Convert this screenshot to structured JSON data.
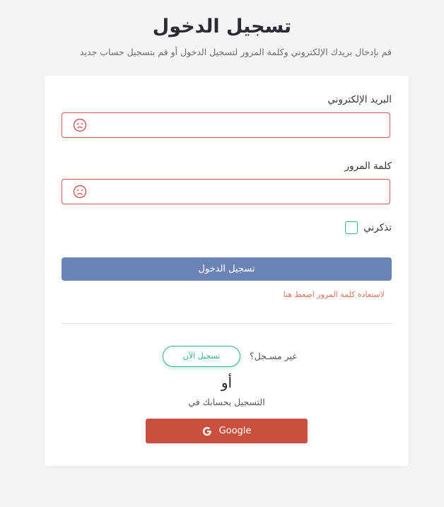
{
  "header": {
    "title": "تسجيل الدخول",
    "subtitle": "قم بإدخال بريدك الإلكتروني وكلمة المرور لتسجيل الدخول أو قم بتسجيل حساب جديد"
  },
  "form": {
    "email_label": "البريد الإلكتروني",
    "email_value": "",
    "password_label": "كلمة المرور",
    "password_value": "",
    "remember_label": "تذكرني",
    "remember_checked": false,
    "submit_label": "تسجيل الدخول",
    "forgot_link": "لاستعادة كلمة المرور اضغط هنا",
    "field_error_icon": "sad-face-icon",
    "error_color": "#d9534f"
  },
  "signup": {
    "prompt": "غير مسـجل؟",
    "register_button": "تسجيل الآن",
    "or_text": "أو",
    "social_prompt": "التسجيل بحسابك في",
    "google_button": "Google",
    "google_icon": "google-g-icon"
  },
  "colors": {
    "primary_button": "#6c83b6",
    "accent_green": "#2bb48a",
    "google_red": "#c9503f",
    "link_orange": "#e0745a"
  }
}
